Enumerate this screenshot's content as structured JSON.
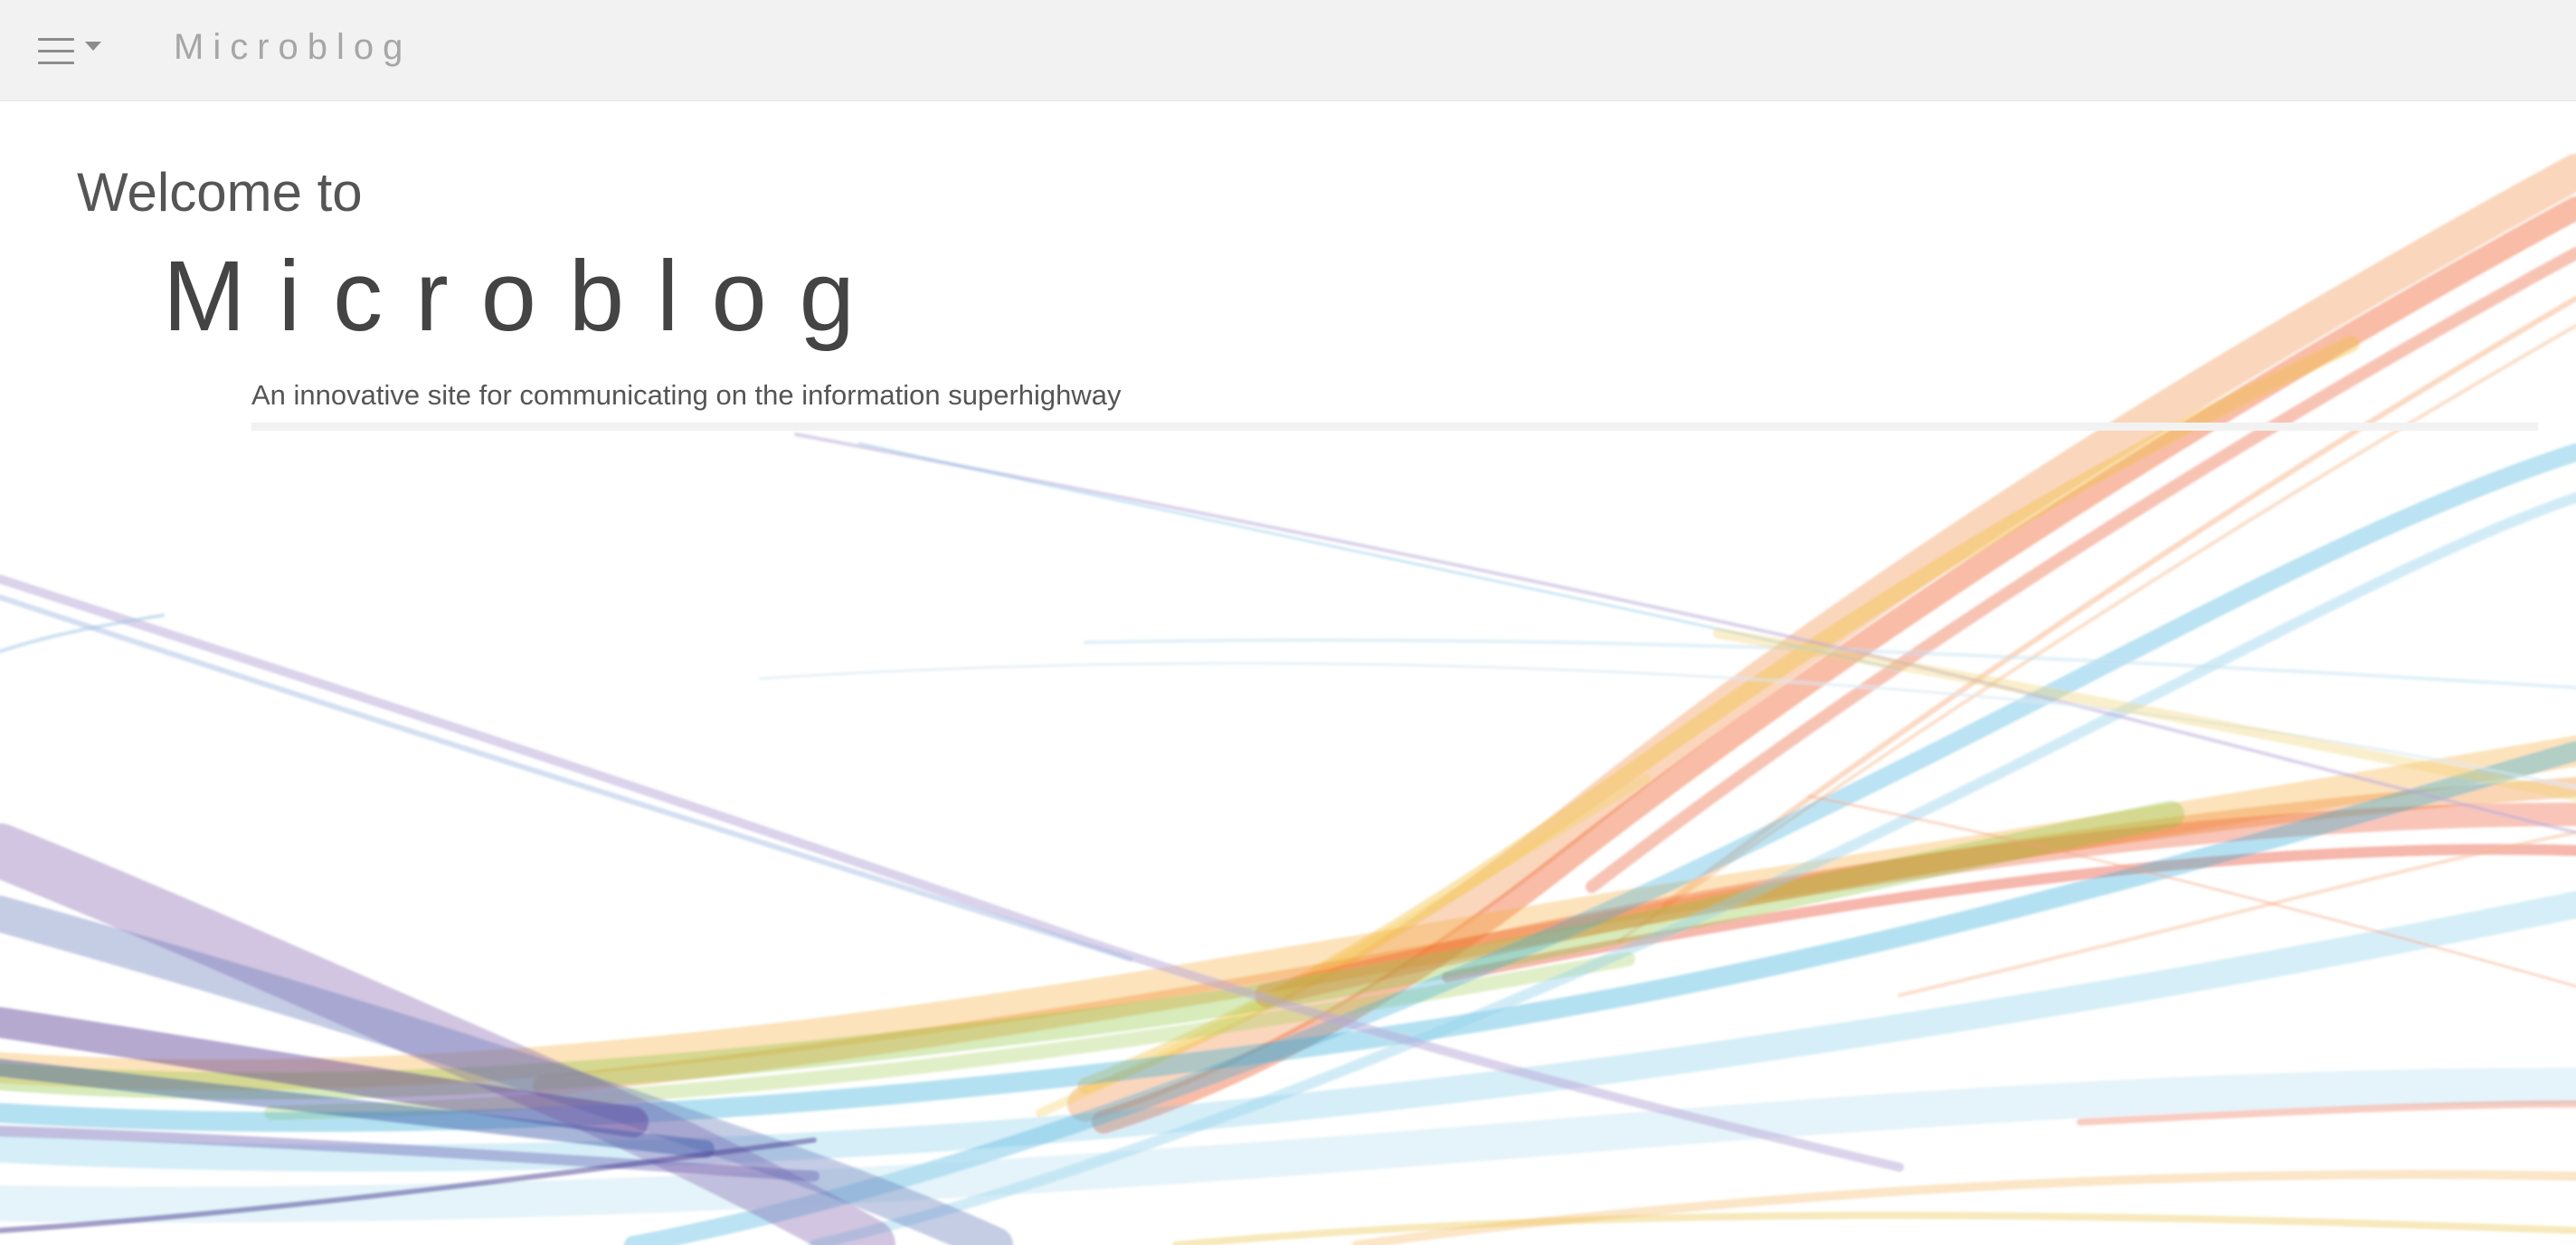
{
  "navbar": {
    "menu_icon": "hamburger-icon",
    "caret_icon": "caret-down-icon",
    "brand": "Microblog",
    "background": "#f2f2f2",
    "brand_color": "#a6a6a6"
  },
  "hero": {
    "welcome": "Welcome to",
    "title": "Microblog",
    "tagline": "An innovative site for communicating on the information superhighway",
    "text_color": "#555555"
  },
  "background_art": {
    "description_icon": "rainbow-ribbons-decoration",
    "colors": [
      "#e94b2f",
      "#f0932b",
      "#f4c430",
      "#8dc63f",
      "#29a9d8",
      "#6a4c9c"
    ]
  }
}
